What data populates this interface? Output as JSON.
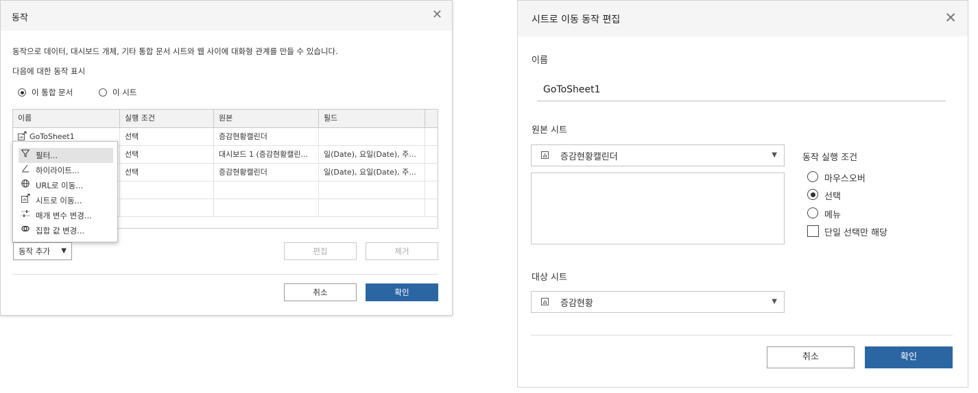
{
  "actions_dialog": {
    "title": "동작",
    "close": "✕",
    "description": "동작으로 데이터, 대시보드 개체, 기타 통합 문서 시트와 웹 사이에 대화형 관계를 만들 수 있습니다.",
    "show_label": "다음에 대한 동작 표시",
    "scope_options": [
      {
        "label": "이 통합 문서",
        "selected": true
      },
      {
        "label": "이 시트",
        "selected": false
      }
    ],
    "columns": [
      "이름",
      "실행 조건",
      "원본",
      "필드"
    ],
    "rows": [
      {
        "name": "GoToSheet1",
        "trigger": "선택",
        "source": "증감현황캘린더",
        "fields": ""
      },
      {
        "name": "",
        "trigger": "선택",
        "source": "대시보드 1 (증감현황캘린...",
        "fields": "일(Date), 요일(Date), 주..."
      },
      {
        "name": "",
        "trigger": "선택",
        "source": "증감현황캘린더",
        "fields": "일(Date), 요일(Date), 주..."
      }
    ],
    "menu": [
      {
        "icon": "filter-icon",
        "label": "필터..."
      },
      {
        "icon": "highlight-icon",
        "label": "하이라이트..."
      },
      {
        "icon": "globe-icon",
        "label": "URL로 이동..."
      },
      {
        "icon": "go-to-sheet-icon",
        "label": "시트로 이동..."
      },
      {
        "icon": "parameter-icon",
        "label": "매개 변수 변경..."
      },
      {
        "icon": "set-icon",
        "label": "집합 값 변경..."
      }
    ],
    "add_action": "동작 추가",
    "edit": "편집",
    "remove": "제거",
    "cancel": "취소",
    "ok": "확인"
  },
  "edit_dialog": {
    "title": "시트로 이동 동작 편집",
    "close": "✕",
    "name_label": "이름",
    "name_value": "GoToSheet1",
    "source_label": "원본 시트",
    "source_value": "증감현황캘린더",
    "run_label": "동작 실행 조건",
    "run_options": [
      {
        "label": "마우스오버",
        "selected": false
      },
      {
        "label": "선택",
        "selected": true
      },
      {
        "label": "메뉴",
        "selected": false
      }
    ],
    "single_select": "단일 선택만 해당",
    "target_label": "대상 시트",
    "target_value": "증감현황",
    "cancel": "취소",
    "ok": "확인"
  }
}
